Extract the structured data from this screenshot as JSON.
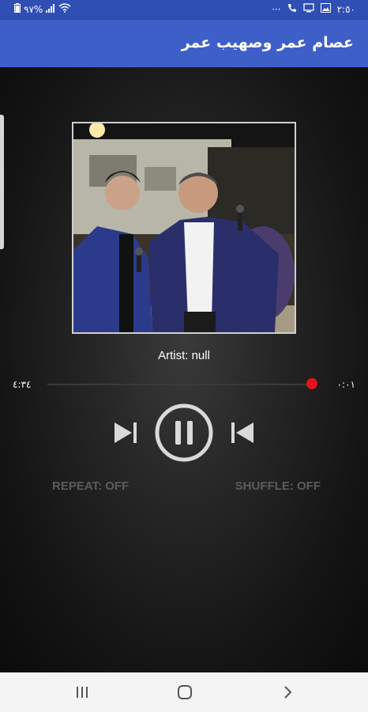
{
  "status_bar": {
    "battery": "٩٧%",
    "time": "٢:٥٠",
    "dots": "···"
  },
  "app_bar": {
    "title": "عصام عمر وصهيب عمر"
  },
  "player": {
    "artist_text": "Artist: null",
    "total_time": "٤:٣٤",
    "elapsed_time": "٠:٠١",
    "progress": 0.03,
    "repeat_label": "REPEAT: OFF",
    "shuffle_label": "SHUFFLE: OFF",
    "accent_color": "#e3141a"
  },
  "nav_bar": {
    "icons": [
      "recents-icon",
      "home-icon",
      "back-icon"
    ]
  }
}
